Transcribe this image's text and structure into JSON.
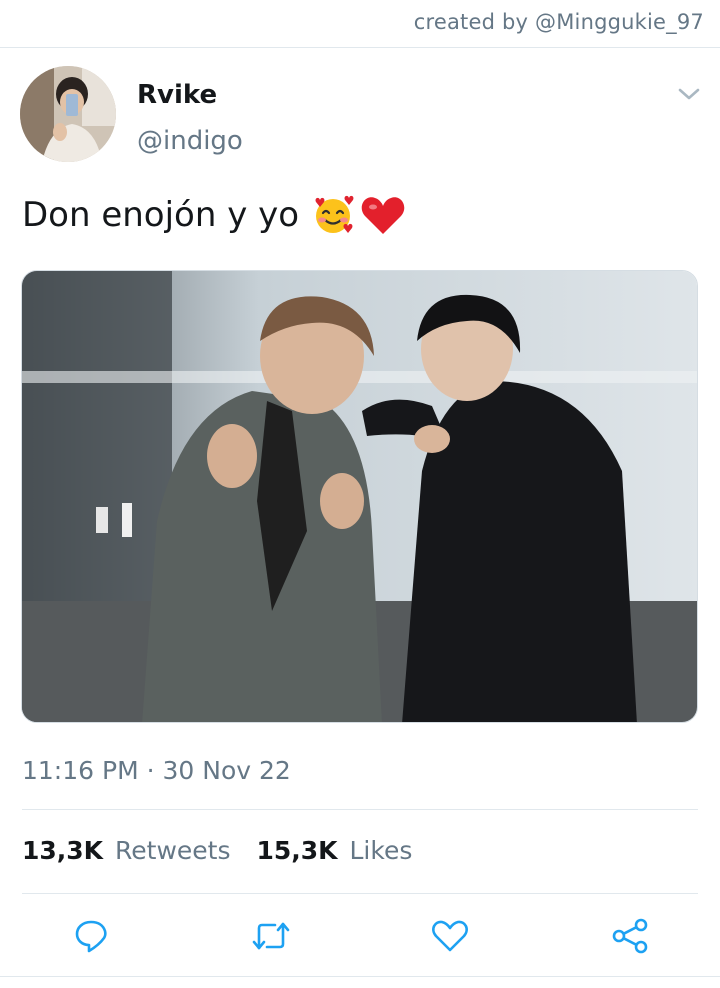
{
  "header": {
    "credit": "created by @Minggukie_97"
  },
  "tweet": {
    "author": {
      "display_name": "Rvike",
      "handle": "@indigo"
    },
    "text": "Don enojón y yo",
    "emojis": [
      "smiling-face-with-hearts",
      "red-heart"
    ],
    "timestamp": "11:16 PM · 30 Nov 22",
    "stats": {
      "retweets_count": "13,3K",
      "retweets_label": "Retweets",
      "likes_count": "15,3K",
      "likes_label": "Likes"
    }
  },
  "actions": [
    "reply-icon",
    "retweet-icon",
    "like-icon",
    "share-icon"
  ],
  "colors": {
    "text": "#14171a",
    "muted": "#657786",
    "divider": "#e1e8ed",
    "icon": "#1da1f2"
  }
}
